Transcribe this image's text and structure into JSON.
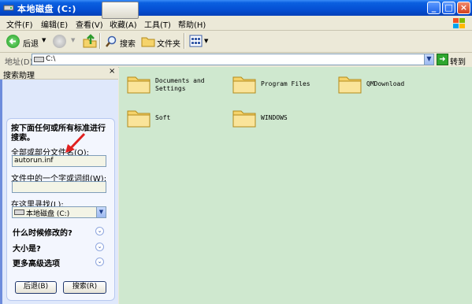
{
  "window": {
    "title": "本地磁盘 (C:)",
    "min": "_",
    "max": "□",
    "close": "×"
  },
  "menu": [
    "文件(F)",
    "编辑(E)",
    "查看(V)",
    "收藏(A)",
    "工具(T)",
    "帮助(H)"
  ],
  "toolbar": {
    "back": "后退",
    "search": "搜索",
    "folders": "文件夹"
  },
  "address": {
    "label": "地址(D)",
    "value": "C:\\",
    "go": "转到"
  },
  "sidebar": {
    "title": "搜索助理",
    "close": "×",
    "prompt": "按下面任何或所有标准进行搜索。",
    "name_label": "全部或部分文件名(O):",
    "name_value": "autorun.inf",
    "phrase_label": "文件中的一个字或词组(W):",
    "phrase_value": "",
    "look_in_label": "在这里寻找(L):",
    "look_in_value": "本地磁盘 (C:)",
    "option_modified": "什么时候修改的?",
    "option_size": "大小是?",
    "option_advanced": "更多高级选项",
    "back_button": "后退(B)",
    "search_button": "搜索(R)"
  },
  "folders": [
    {
      "name": "Documents and\nSettings"
    },
    {
      "name": "Program Files"
    },
    {
      "name": "QMDownload"
    },
    {
      "name": "Soft"
    },
    {
      "name": "WINDOWS"
    }
  ],
  "colors": {
    "titlebar": "#0550d4",
    "sidebar": "#6d8cdc",
    "main_bg": "#cfe8cf",
    "arrow": "#e02020",
    "folder": "#f5d36b"
  }
}
